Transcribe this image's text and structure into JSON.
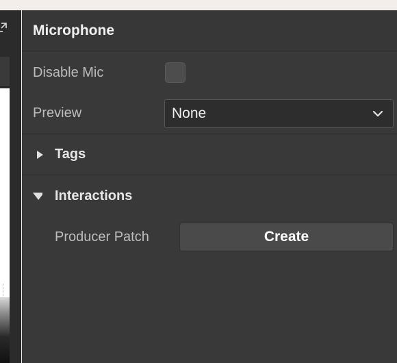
{
  "panel": {
    "title": "Microphone",
    "disable_mic": {
      "label": "Disable Mic",
      "checked": false
    },
    "preview": {
      "label": "Preview",
      "value": "None"
    },
    "sections": {
      "tags": {
        "title": "Tags",
        "expanded": false
      },
      "interactions": {
        "title": "Interactions",
        "expanded": true,
        "producer_patch": {
          "label": "Producer Patch",
          "button_label": "Create"
        }
      }
    }
  },
  "icons": {
    "expand": "expand-icon",
    "chevron": "chevron-down-icon",
    "collapsed": "caret-right-icon",
    "expanded": "caret-down-icon"
  },
  "colors": {
    "panel_bg": "#393939",
    "header_text": "#f1f1f1",
    "label_text": "#bdbdbd",
    "button_bg": "#4a4a4a",
    "select_bg": "#2d2d2d"
  }
}
